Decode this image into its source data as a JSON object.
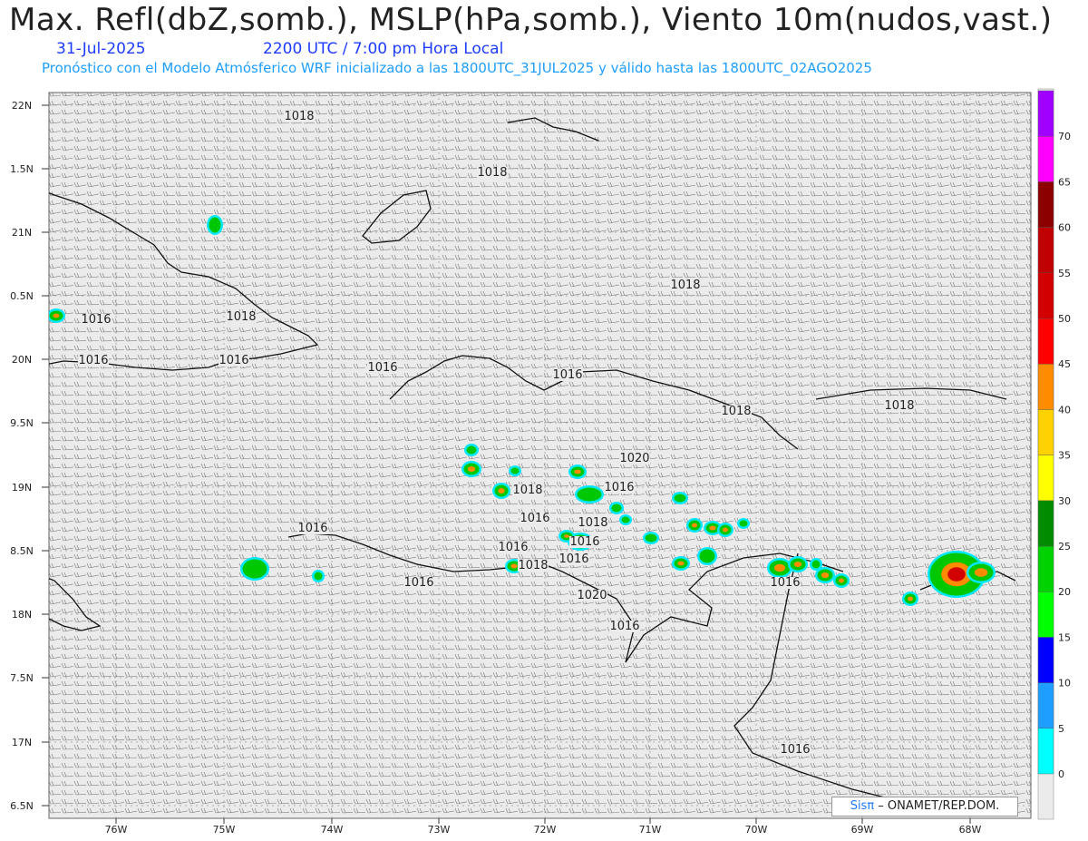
{
  "header": {
    "title": "Max. Refl(dbZ,somb.), MSLP(hPa,somb.), Viento 10m(nudos,vast.)",
    "date": "31-Jul-2025",
    "time": "2200 UTC / 7:00 pm Hora Local",
    "forecast_note": "Pronóstico con el Modelo Atmósferico WRF inicializado a las 1800UTC_31JUL2025 y válido hasta las  1800UTC_02AGO2025"
  },
  "axes": {
    "lat_labels": [
      "22N",
      "1.5N",
      "21N",
      "0.5N",
      "20N",
      "9.5N",
      "19N",
      "8.5N",
      "18N",
      "7.5N",
      "17N",
      "6.5N"
    ],
    "lon_labels": [
      "76W",
      "75W",
      "74W",
      "73W",
      "72W",
      "71W",
      "70W",
      "69W",
      "68W"
    ]
  },
  "colorbar": {
    "labels": [
      "0",
      "5",
      "10",
      "15",
      "20",
      "25",
      "30",
      "35",
      "40",
      "45",
      "50",
      "55",
      "60",
      "65",
      "70"
    ],
    "colors": [
      "#00ffff",
      "#1e9eff",
      "#0000ff",
      "#00ff00",
      "#00d200",
      "#008c00",
      "#ffff00",
      "#ffd200",
      "#ff8c00",
      "#ff0000",
      "#d20000",
      "#c00000",
      "#8c0000",
      "#ff00ff",
      "#a000ff"
    ]
  },
  "isobars": [
    {
      "label": "1018"
    },
    {
      "label": "1018"
    },
    {
      "label": "1018"
    },
    {
      "label": "1018"
    },
    {
      "label": "1016"
    },
    {
      "label": "1016"
    },
    {
      "label": "1016"
    },
    {
      "label": "1016"
    },
    {
      "label": "1016"
    },
    {
      "label": "1018"
    },
    {
      "label": "1018"
    },
    {
      "label": "1020"
    },
    {
      "label": "1016"
    },
    {
      "label": "1018"
    },
    {
      "label": "1016"
    },
    {
      "label": "1018"
    },
    {
      "label": "1016"
    },
    {
      "label": "1016"
    },
    {
      "label": "1018"
    },
    {
      "label": "1016"
    },
    {
      "label": "1016"
    },
    {
      "label": "1016"
    },
    {
      "label": "1016"
    },
    {
      "label": "1020"
    },
    {
      "label": "1016"
    },
    {
      "label": "1016"
    }
  ],
  "credit": {
    "sis": "Sisπ",
    "rest": " – ONAMET/REP.DOM."
  }
}
